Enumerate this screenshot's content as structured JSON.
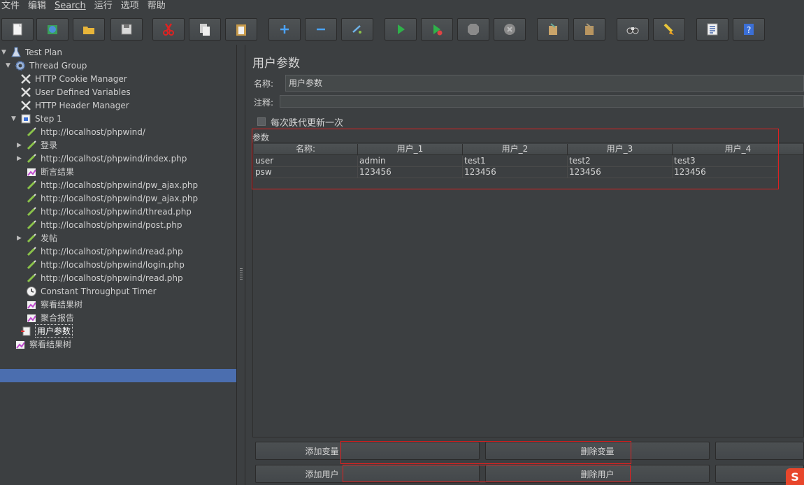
{
  "menu": [
    "文件",
    "编辑",
    "Search",
    "运行",
    "选项",
    "帮助"
  ],
  "toolbar": {
    "buttons": [
      "new-icon",
      "templates-icon",
      "open-icon",
      "save-icon",
      "cut-icon",
      "copy-icon",
      "paste-icon",
      "expand-icon",
      "collapse-icon",
      "toggle-icon",
      "start-icon",
      "start-no-pause-icon",
      "stop-icon",
      "shutdown-icon",
      "clear-icon",
      "clear-all-icon",
      "search-icon",
      "reset-search-icon",
      "function-helper-icon",
      "help-icon"
    ]
  },
  "tree": {
    "nodes": [
      {
        "label": "Test Plan",
        "icon": "test-plan-icon",
        "arrow": "▼"
      },
      {
        "label": "Thread Group",
        "icon": "gear-icon",
        "arrow": "▼"
      },
      {
        "label": "HTTP Cookie Manager",
        "icon": "tools-icon",
        "arrow": ""
      },
      {
        "label": "User Defined Variables",
        "icon": "tools-icon",
        "arrow": ""
      },
      {
        "label": "HTTP Header Manager",
        "icon": "tools-icon",
        "arrow": ""
      },
      {
        "label": "Step 1",
        "icon": "controller-icon",
        "arrow": "▼"
      },
      {
        "label": "http://localhost/phpwind/",
        "icon": "sampler-icon",
        "arrow": ""
      },
      {
        "label": "登录",
        "icon": "sampler-icon",
        "arrow": "▶"
      },
      {
        "label": "http://localhost/phpwind/index.php",
        "icon": "sampler-icon",
        "arrow": "▶"
      },
      {
        "label": "断言结果",
        "icon": "listener-icon",
        "arrow": ""
      },
      {
        "label": "http://localhost/phpwind/pw_ajax.php",
        "icon": "sampler-icon",
        "arrow": ""
      },
      {
        "label": "http://localhost/phpwind/pw_ajax.php",
        "icon": "sampler-icon",
        "arrow": ""
      },
      {
        "label": "http://localhost/phpwind/thread.php",
        "icon": "sampler-icon",
        "arrow": ""
      },
      {
        "label": "http://localhost/phpwind/post.php",
        "icon": "sampler-icon",
        "arrow": ""
      },
      {
        "label": "发帖",
        "icon": "sampler-icon",
        "arrow": "▶"
      },
      {
        "label": "http://localhost/phpwind/read.php",
        "icon": "sampler-icon",
        "arrow": ""
      },
      {
        "label": "http://localhost/phpwind/login.php",
        "icon": "sampler-icon",
        "arrow": ""
      },
      {
        "label": "http://localhost/phpwind/read.php",
        "icon": "sampler-icon",
        "arrow": ""
      },
      {
        "label": "Constant Throughput Timer",
        "icon": "timer-icon",
        "arrow": ""
      },
      {
        "label": "察看结果树",
        "icon": "listener-icon",
        "arrow": ""
      },
      {
        "label": "聚合报告",
        "icon": "listener-icon",
        "arrow": ""
      },
      {
        "label": "用户参数",
        "icon": "preprocessor-icon",
        "arrow": ""
      },
      {
        "label": "察看结果树",
        "icon": "listener-icon",
        "arrow": ""
      }
    ]
  },
  "panel": {
    "title": "用户参数",
    "name_label": "名称:",
    "name_value": "用户参数",
    "comment_label": "注释:",
    "comment_value": "",
    "checkbox_label": "每次跌代更新一次",
    "params_title": "参数",
    "table": {
      "headers": [
        "名称:",
        "用户_1",
        "用户_2",
        "用户_3",
        "用户_4"
      ],
      "rows": [
        [
          "user",
          "admin",
          "test1",
          "test2",
          "test3"
        ],
        [
          "psw",
          "123456",
          "123456",
          "123456",
          "123456"
        ]
      ]
    },
    "buttons": {
      "add_var": "添加变量",
      "del_var": "删除变量",
      "add_user": "添加用户",
      "del_user": "删除用户"
    }
  },
  "colors": {
    "background": "#3c3f41",
    "selection": "#4b6eaf",
    "highlight_box": "#e02020"
  },
  "watermark": "S"
}
